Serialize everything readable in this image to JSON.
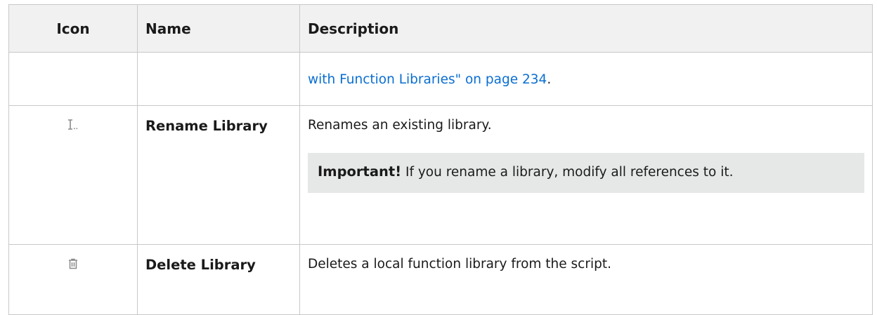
{
  "table": {
    "headers": {
      "icon": "Icon",
      "name": "Name",
      "description": "Description"
    },
    "continued_row": {
      "link_text": "with Function Libraries\" on page 234",
      "trailing": "."
    },
    "rows": [
      {
        "icon": "rename-icon",
        "name": "Rename Library",
        "description": "Renames an existing library.",
        "note": {
          "label": "Important!",
          "text": " If you rename a library, modify all references to it."
        }
      },
      {
        "icon": "trash-icon",
        "name": "Delete Library",
        "description": "Deletes a local function library from the script."
      }
    ],
    "link_color": "#0a6ed1"
  }
}
